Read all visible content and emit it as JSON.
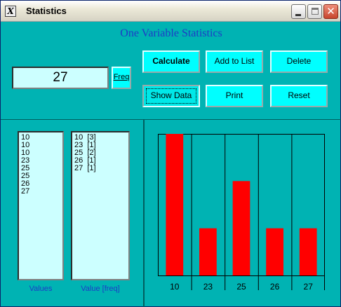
{
  "window": {
    "title": "Statistics",
    "icon_glyph": "X"
  },
  "main": {
    "heading": "One Variable Statistics",
    "value_input": "27",
    "freq_label": "Freq",
    "buttons": {
      "calculate": "Calculate",
      "add_to_list": "Add to List",
      "delete": "Delete",
      "show_data": "Show Data",
      "print": "Print",
      "reset": "Reset"
    }
  },
  "lists": {
    "values": [
      "10",
      "10",
      "10",
      "23",
      "25",
      "25",
      "26",
      "27"
    ],
    "values_caption": "Values",
    "freq": [
      "10  [3]",
      "23  [1]",
      "25  [2]",
      "26  [1]",
      "27  [1]"
    ],
    "freq_caption": "Value [freq]"
  },
  "colors": {
    "bar": "#ff0000",
    "background": "#00b3b3",
    "list_bg": "#ccffff",
    "button": "#00ffff",
    "caption": "#1d3cc7"
  },
  "chart_data": {
    "type": "bar",
    "categories": [
      "10",
      "23",
      "25",
      "26",
      "27"
    ],
    "values": [
      3,
      1,
      2,
      1,
      1
    ],
    "title": "",
    "xlabel": "",
    "ylabel": "",
    "ylim": [
      0,
      3
    ],
    "grid": false
  }
}
